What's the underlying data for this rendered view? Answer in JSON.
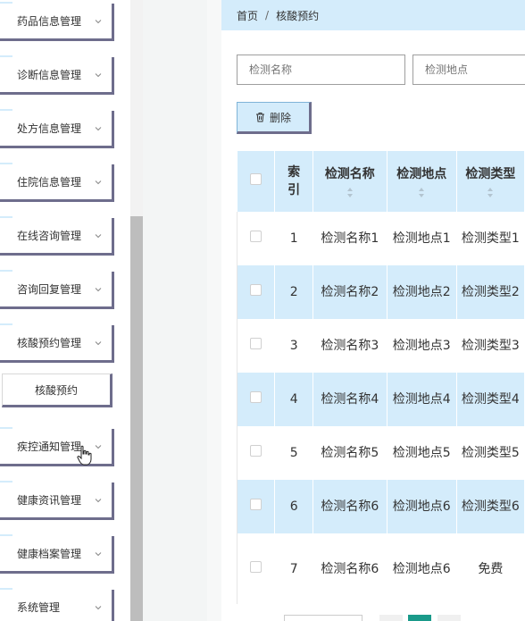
{
  "sidebar": {
    "menu": [
      {
        "label": "药品信息管理"
      },
      {
        "label": "诊断信息管理"
      },
      {
        "label": "处方信息管理"
      },
      {
        "label": "住院信息管理"
      },
      {
        "label": "在线咨询管理"
      },
      {
        "label": "咨询回复管理"
      },
      {
        "label": "核酸预约管理"
      },
      {
        "label": "疾控通知管理"
      },
      {
        "label": "健康资讯管理"
      },
      {
        "label": "健康档案管理"
      },
      {
        "label": "系统管理"
      }
    ],
    "submenu_active": "核酸预约"
  },
  "breadcrumb": {
    "home": "首页",
    "separator": "/",
    "current": "核酸预约"
  },
  "search": {
    "name_placeholder": "检测名称",
    "location_placeholder": "检测地点"
  },
  "toolbar": {
    "delete_label": "删除"
  },
  "table": {
    "headers": {
      "index": "索引",
      "name": "检测名称",
      "location": "检测地点",
      "type": "检测类型"
    },
    "rows": [
      {
        "index": "1",
        "name": "检测名称1",
        "location": "检测地点1",
        "type": "检测类型1"
      },
      {
        "index": "2",
        "name": "检测名称2",
        "location": "检测地点2",
        "type": "检测类型2"
      },
      {
        "index": "3",
        "name": "检测名称3",
        "location": "检测地点3",
        "type": "检测类型3"
      },
      {
        "index": "4",
        "name": "检测名称4",
        "location": "检测地点4",
        "type": "检测类型4"
      },
      {
        "index": "5",
        "name": "检测名称5",
        "location": "检测地点5",
        "type": "检测类型5"
      },
      {
        "index": "6",
        "name": "检测名称6",
        "location": "检测地点6",
        "type": "检测类型6"
      },
      {
        "index": "7",
        "name": "检测名称6",
        "location": "检测地点6",
        "type": "免费"
      }
    ]
  },
  "colors": {
    "accent": "#d4ecfb",
    "border_shadow": "#6e6d8c",
    "pager_active": "#1a9a8a"
  },
  "icons": {
    "menu_expand": "chevron-down-icon",
    "delete": "trash-icon",
    "sort": "sort-icon",
    "cursor": "hand-cursor-icon"
  }
}
